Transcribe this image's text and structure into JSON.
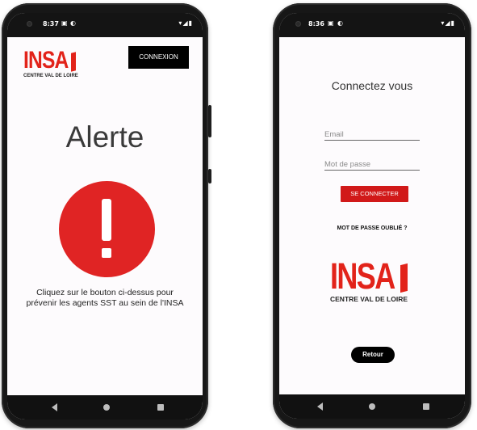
{
  "left_phone": {
    "status": {
      "time": "8:37",
      "icons_left": [
        "notification-icon",
        "data-saver-icon"
      ],
      "icons_right": [
        "wifi-icon",
        "signal-icon",
        "battery-icon"
      ]
    },
    "logo": {
      "word": "INSA",
      "subtitle": "CENTRE VAL DE LOIRE"
    },
    "connexion_button": "CONNEXION",
    "alert_title": "Alerte",
    "alert_button_icon": "exclamation-icon",
    "alert_color": "#e02424",
    "description": "Cliquez sur le bouton ci-dessus pour prévenir les agents SST au sein de l'INSA"
  },
  "right_phone": {
    "status": {
      "time": "8:36",
      "icons_left": [
        "notification-icon",
        "data-saver-icon"
      ],
      "icons_right": [
        "wifi-icon",
        "signal-icon",
        "battery-icon"
      ]
    },
    "title": "Connectez vous",
    "email_placeholder": "Email",
    "password_placeholder": "Mot de passe",
    "login_button": "SE CONNECTER",
    "forgot_link": "MOT DE PASSE OUBLIÉ ?",
    "logo": {
      "word": "INSA",
      "subtitle": "CENTRE VAL DE LOIRE"
    },
    "back_button": "Retour",
    "accent_color": "#d11919"
  },
  "nav_icons": [
    "back-icon",
    "home-icon",
    "recents-icon"
  ]
}
